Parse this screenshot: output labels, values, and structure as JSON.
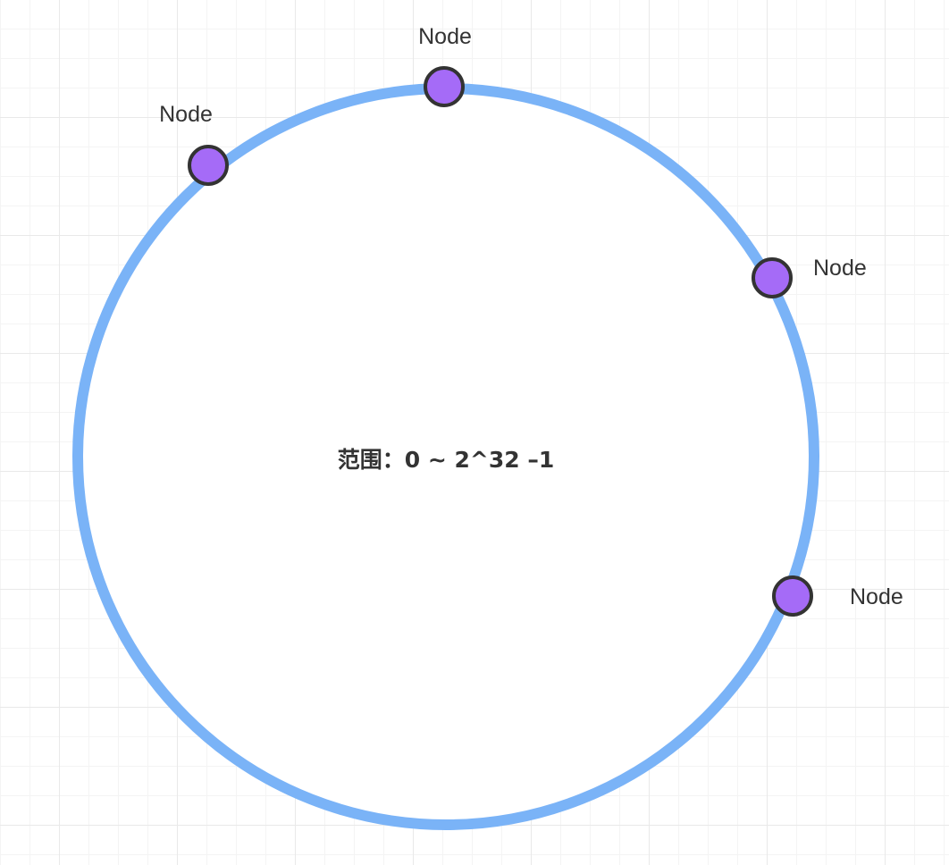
{
  "diagram": {
    "range_label": "范围：0 ~ 2^32 –1",
    "ring_color": "#7ab3f7",
    "node_fill": "#a56bf7",
    "node_stroke": "#333333",
    "nodes": [
      {
        "label": "Node"
      },
      {
        "label": "Node"
      },
      {
        "label": "Node"
      },
      {
        "label": "Node"
      }
    ]
  }
}
